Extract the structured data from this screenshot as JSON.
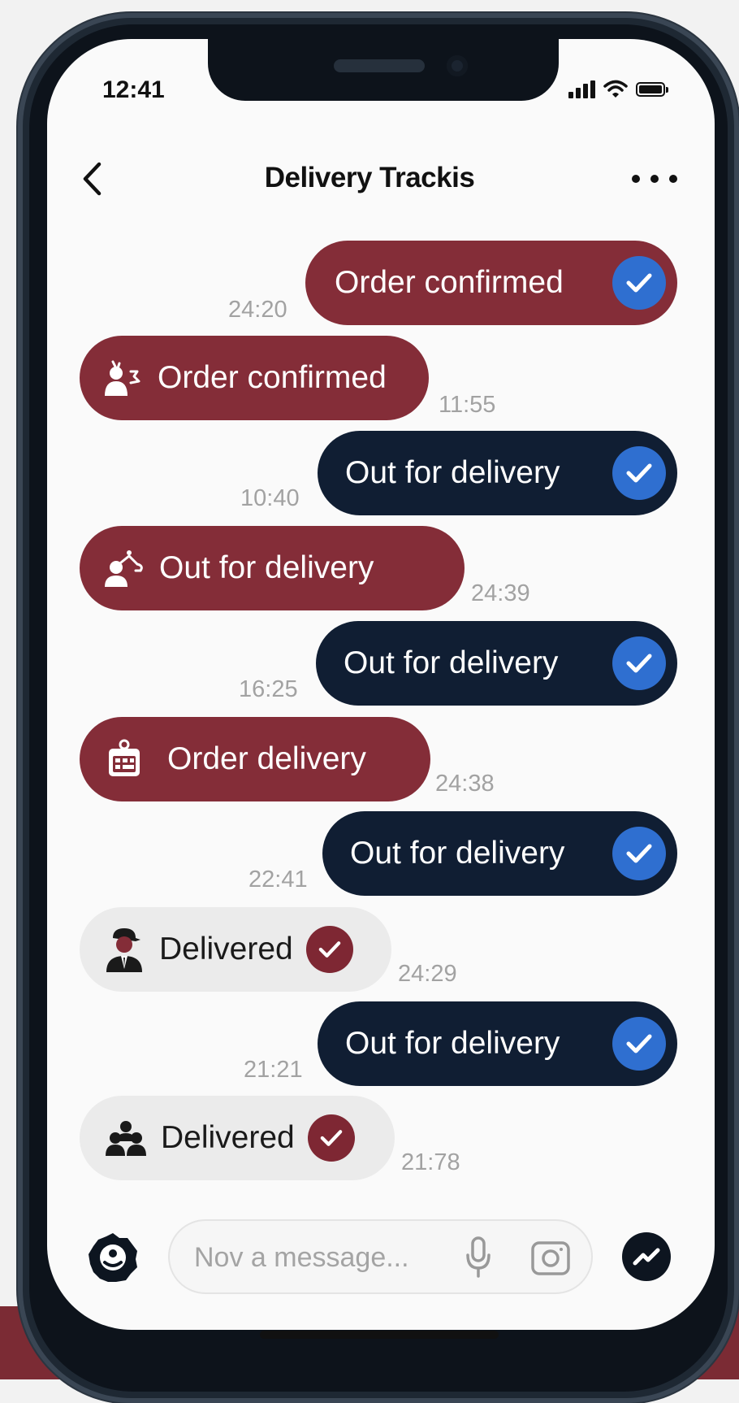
{
  "status_bar": {
    "time": "12:41"
  },
  "header": {
    "title": "Delivery Trackis"
  },
  "messages": [
    {
      "side": "right",
      "style": "red",
      "text": "Order confirmed",
      "time": "24:20",
      "check": "blue"
    },
    {
      "side": "left",
      "style": "red",
      "text": "Order confirmed",
      "time": "11:55",
      "icon": "courier-icon"
    },
    {
      "side": "right",
      "style": "navy",
      "text": "Out for delivery",
      "time": "10:40",
      "check": "blue"
    },
    {
      "side": "left",
      "style": "red",
      "text": "Out for delivery",
      "time": "24:39",
      "icon": "route-icon"
    },
    {
      "side": "right",
      "style": "navy",
      "text": "Out for delivery",
      "time": "16:25",
      "check": "blue"
    },
    {
      "side": "left",
      "style": "red",
      "text": "Order delivery",
      "time": "24:38",
      "icon": "calendar-icon"
    },
    {
      "side": "right",
      "style": "navy",
      "text": "Out for delivery",
      "time": "22:41",
      "check": "blue"
    },
    {
      "side": "left",
      "style": "grey",
      "text": "Delivered",
      "time": "24:29",
      "icon": "delivery-person-icon",
      "check": "maroon"
    },
    {
      "side": "right",
      "style": "navy",
      "text": "Out for delivery",
      "time": "21:21",
      "check": "blue"
    },
    {
      "side": "left",
      "style": "grey",
      "text": "Delivered",
      "time": "21:78",
      "icon": "group-icon",
      "check": "maroon"
    }
  ],
  "composer": {
    "placeholder": "Nov a message..."
  },
  "colors": {
    "red": "#842d38",
    "navy": "#101e33",
    "check_blue": "#2f6fd0",
    "check_maroon": "#7e2733"
  }
}
